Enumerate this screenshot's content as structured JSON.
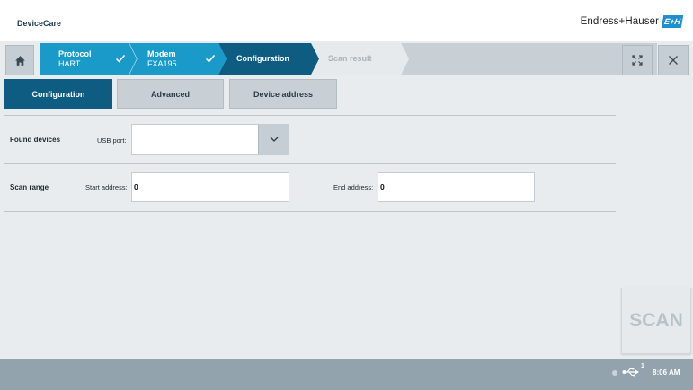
{
  "header": {
    "app_title": "DeviceCare",
    "brand_name": "Endress+Hauser",
    "brand_logo_text": "E+H"
  },
  "nav": {
    "home_icon": "home-icon",
    "steps": [
      {
        "title": "Protocol",
        "subtitle": "HART",
        "state": "completed"
      },
      {
        "title": "Modem",
        "subtitle": "FXA195",
        "state": "completed"
      },
      {
        "title": "Configuration",
        "subtitle": "",
        "state": "active"
      },
      {
        "title": "Scan result",
        "subtitle": "",
        "state": "disabled"
      }
    ],
    "fullscreen_icon": "fullscreen-icon",
    "close_icon": "close-icon"
  },
  "tabs": [
    {
      "label": "Configuration",
      "active": true
    },
    {
      "label": "Advanced",
      "active": false
    },
    {
      "label": "Device address",
      "active": false
    }
  ],
  "found_devices": {
    "label": "Found devices",
    "usb_port_label": "USB port:",
    "usb_port_value": ""
  },
  "scan_range": {
    "label": "Scan range",
    "start_label": "Start address:",
    "start_value": "0",
    "end_label": "End address:",
    "end_value": "0"
  },
  "scan_button": {
    "label": "SCAN",
    "enabled": false
  },
  "footer": {
    "usb_count": "1",
    "time": "8:06 AM"
  },
  "colors": {
    "active_step": "#0f5c82",
    "completed_step": "#1a9ac9",
    "footer": "#93a3ad",
    "brand": "#1e8fd0"
  }
}
